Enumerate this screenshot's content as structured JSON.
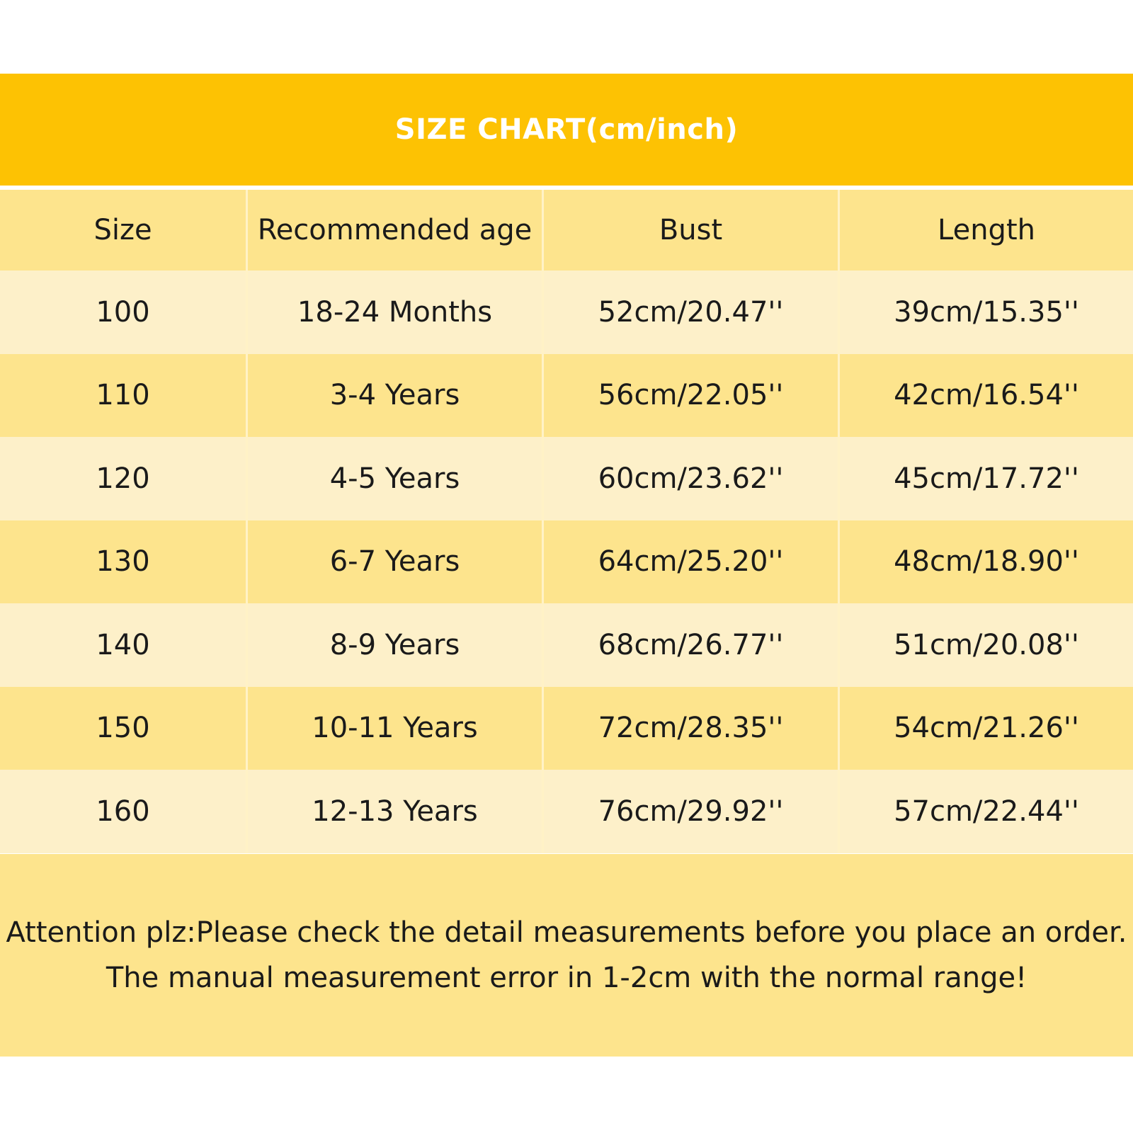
{
  "title": "SIZE CHART(cm/inch)",
  "colors": {
    "banner": "#fdc203",
    "row_dark": "#fde48d",
    "row_light": "#fdf0c9",
    "title_text": "#ffffff"
  },
  "table": {
    "headers": [
      "Size",
      "Recommended age",
      "Bust",
      "Length"
    ],
    "rows": [
      [
        "100",
        "18-24 Months",
        "52cm/20.47''",
        "39cm/15.35''"
      ],
      [
        "110",
        "3-4 Years",
        "56cm/22.05''",
        "42cm/16.54''"
      ],
      [
        "120",
        "4-5 Years",
        "60cm/23.62''",
        "45cm/17.72''"
      ],
      [
        "130",
        "6-7 Years",
        "64cm/25.20''",
        "48cm/18.90''"
      ],
      [
        "140",
        "8-9 Years",
        "68cm/26.77''",
        "51cm/20.08''"
      ],
      [
        "150",
        "10-11 Years",
        "72cm/28.35''",
        "54cm/21.26''"
      ],
      [
        "160",
        "12-13 Years",
        "76cm/29.92''",
        "57cm/22.44''"
      ]
    ]
  },
  "note": {
    "line1": "Attention plz:Please check the detail measurements before you place an order.",
    "line2": "The manual measurement error in 1-2cm with the normal range!"
  }
}
